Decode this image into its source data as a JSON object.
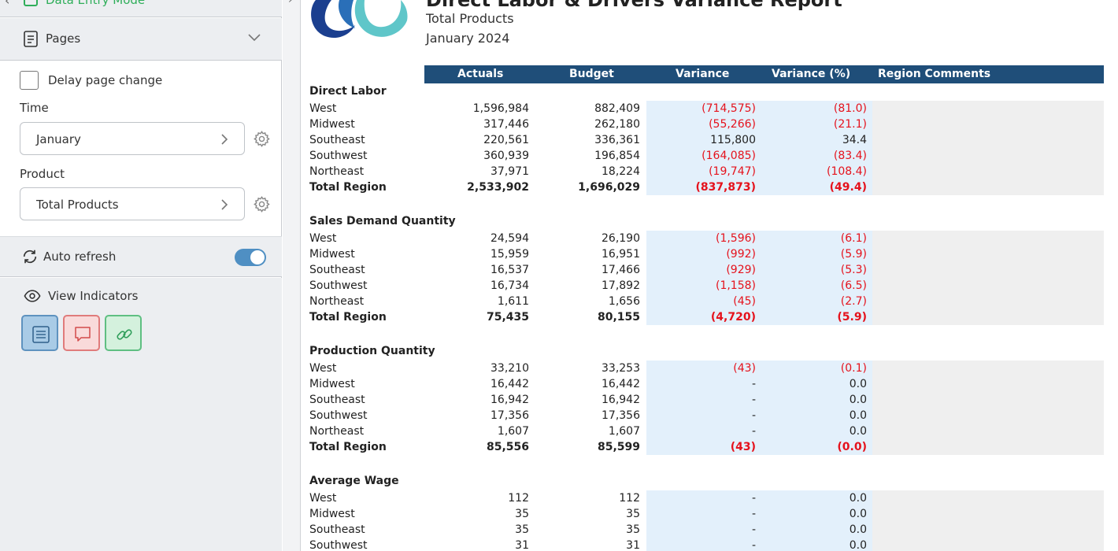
{
  "sidebar": {
    "mode_label": "Data Entry Mode",
    "pages_label": "Pages",
    "delay_label": "Delay page change",
    "time_label": "Time",
    "time_value": "January",
    "product_label": "Product",
    "product_value": "Total Products",
    "auto_refresh_label": "Auto refresh",
    "auto_refresh_on": true,
    "view_indicators_label": "View Indicators",
    "indicator_icons": [
      "list-icon",
      "comment-icon",
      "link-icon"
    ],
    "accent_color": "#4f8fc3"
  },
  "report": {
    "title": "Direct Labor & Drivers Variance Report",
    "subtitle_product": "Total Products",
    "subtitle_period": "January 2024",
    "header_color": "#1f4e79",
    "negative_color": "#e5121c",
    "columns": [
      "Actuals",
      "Budget",
      "Variance",
      "Variance (%)",
      "Region Comments"
    ],
    "sections": [
      {
        "title": "Direct Labor",
        "rows": [
          {
            "label": "West",
            "actuals": "1,596,984",
            "budget": "882,409",
            "variance": "(714,575)",
            "pct": "(81.0)"
          },
          {
            "label": "Midwest",
            "actuals": "317,446",
            "budget": "262,180",
            "variance": "(55,266)",
            "pct": "(21.1)"
          },
          {
            "label": "Southeast",
            "actuals": "220,561",
            "budget": "336,361",
            "variance": "115,800",
            "pct": "34.4"
          },
          {
            "label": "Southwest",
            "actuals": "360,939",
            "budget": "196,854",
            "variance": "(164,085)",
            "pct": "(83.4)"
          },
          {
            "label": "Northeast",
            "actuals": "37,971",
            "budget": "18,224",
            "variance": "(19,747)",
            "pct": "(108.4)"
          },
          {
            "label": "Total Region",
            "actuals": "2,533,902",
            "budget": "1,696,029",
            "variance": "(837,873)",
            "pct": "(49.4)",
            "total": true
          }
        ]
      },
      {
        "title": "Sales Demand Quantity",
        "rows": [
          {
            "label": "West",
            "actuals": "24,594",
            "budget": "26,190",
            "variance": "(1,596)",
            "pct": "(6.1)"
          },
          {
            "label": "Midwest",
            "actuals": "15,959",
            "budget": "16,951",
            "variance": "(992)",
            "pct": "(5.9)"
          },
          {
            "label": "Southeast",
            "actuals": "16,537",
            "budget": "17,466",
            "variance": "(929)",
            "pct": "(5.3)"
          },
          {
            "label": "Southwest",
            "actuals": "16,734",
            "budget": "17,892",
            "variance": "(1,158)",
            "pct": "(6.5)"
          },
          {
            "label": "Northeast",
            "actuals": "1,611",
            "budget": "1,656",
            "variance": "(45)",
            "pct": "(2.7)"
          },
          {
            "label": "Total Region",
            "actuals": "75,435",
            "budget": "80,155",
            "variance": "(4,720)",
            "pct": "(5.9)",
            "total": true
          }
        ]
      },
      {
        "title": "Production Quantity",
        "rows": [
          {
            "label": "West",
            "actuals": "33,210",
            "budget": "33,253",
            "variance": "(43)",
            "pct": "(0.1)"
          },
          {
            "label": "Midwest",
            "actuals": "16,442",
            "budget": "16,442",
            "variance": "-",
            "pct": "0.0"
          },
          {
            "label": "Southeast",
            "actuals": "16,942",
            "budget": "16,942",
            "variance": "-",
            "pct": "0.0"
          },
          {
            "label": "Southwest",
            "actuals": "17,356",
            "budget": "17,356",
            "variance": "-",
            "pct": "0.0"
          },
          {
            "label": "Northeast",
            "actuals": "1,607",
            "budget": "1,607",
            "variance": "-",
            "pct": "0.0"
          },
          {
            "label": "Total Region",
            "actuals": "85,556",
            "budget": "85,599",
            "variance": "(43)",
            "pct": "(0.0)",
            "total": true
          }
        ]
      },
      {
        "title": "Average Wage",
        "rows": [
          {
            "label": "West",
            "actuals": "112",
            "budget": "112",
            "variance": "-",
            "pct": "0.0"
          },
          {
            "label": "Midwest",
            "actuals": "35",
            "budget": "35",
            "variance": "-",
            "pct": "0.0"
          },
          {
            "label": "Southeast",
            "actuals": "35",
            "budget": "35",
            "variance": "-",
            "pct": "0.0"
          },
          {
            "label": "Southwest",
            "actuals": "31",
            "budget": "31",
            "variance": "-",
            "pct": "0.0"
          }
        ]
      }
    ]
  }
}
